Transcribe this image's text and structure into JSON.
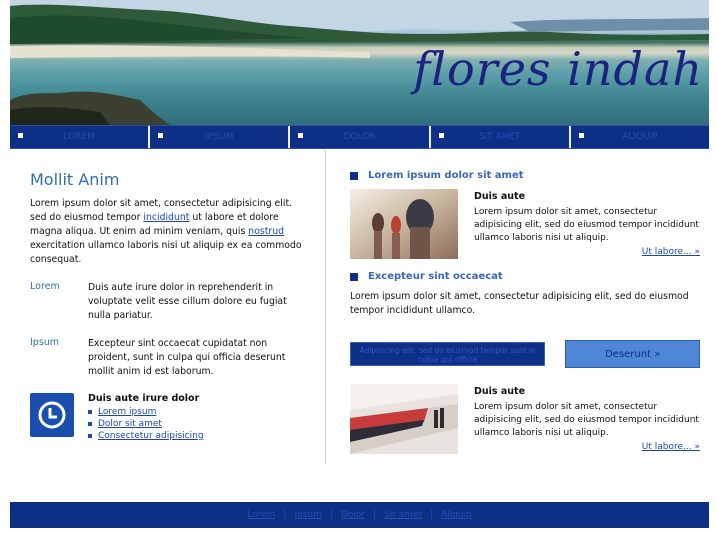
{
  "banner": {
    "title": "flores indah"
  },
  "nav": {
    "items": [
      "Lorem",
      "Ipsum",
      "Dolor",
      "Sit amet",
      "Aliquip"
    ]
  },
  "left": {
    "heading": "Mollit Anim",
    "intro_a": "Lorem ipsum dolor sit amet, consectetur adipisicing elit. sed do eiusmod tempor ",
    "intro_link1": "incididunt",
    "intro_b": " ut labore et dolore magna aliqua. Ut enim ad minim veniam, quis ",
    "intro_link2": "nostrud",
    "intro_c": " exercitation ullamco laboris nisi ut aliquip ex ea commodo consequat.",
    "rows": [
      {
        "label": "Lorem",
        "text": "Duis aute irure dolor in reprehenderit in voluptate velit esse cillum dolore eu fugiat nulla pariatur."
      },
      {
        "label": "Ipsum",
        "text": "Excepteur sint occaecat cupidatat non proident, sunt in culpa qui officia deserunt mollit anim id est laborum."
      }
    ],
    "promo": {
      "title": "Duis aute irure dolor",
      "links": [
        "Lorem ipsum",
        "Dolor sit amet",
        "Consectetur adipisicing"
      ]
    }
  },
  "right": {
    "section1": {
      "heading": "Lorem ipsum dolor sit amet",
      "title": "Duis aute",
      "body": "Lorem ipsum dolor sit amet, consectetur adipisicing elit, sed do eiusmod tempor incididunt ullamco laboris nisi ut aliquip.",
      "more": "Ut labore... »"
    },
    "section2": {
      "heading": "Excepteur sint occaecat",
      "body": "Lorem ipsum dolor sit amet, consectetur adipisicing elit, sed do eiusmod tempor incididunt ullamco."
    },
    "buttons": {
      "small": "Adipisicing elit, sed do eiusmod tempor sunt in culpa qui officia",
      "big": "Deserunt »"
    },
    "section3": {
      "title": "Duis aute",
      "body": "Lorem ipsum dolor sit amet, consectetur adipisicing elit, sed do eiusmod tempor incididunt ullamco laboris nisi ut aliquip.",
      "more": "Ut labore... »"
    }
  },
  "footer": {
    "links": [
      "Lorem",
      "Ipsum",
      "Dolor",
      "Sit amet",
      "Aliquip"
    ]
  }
}
